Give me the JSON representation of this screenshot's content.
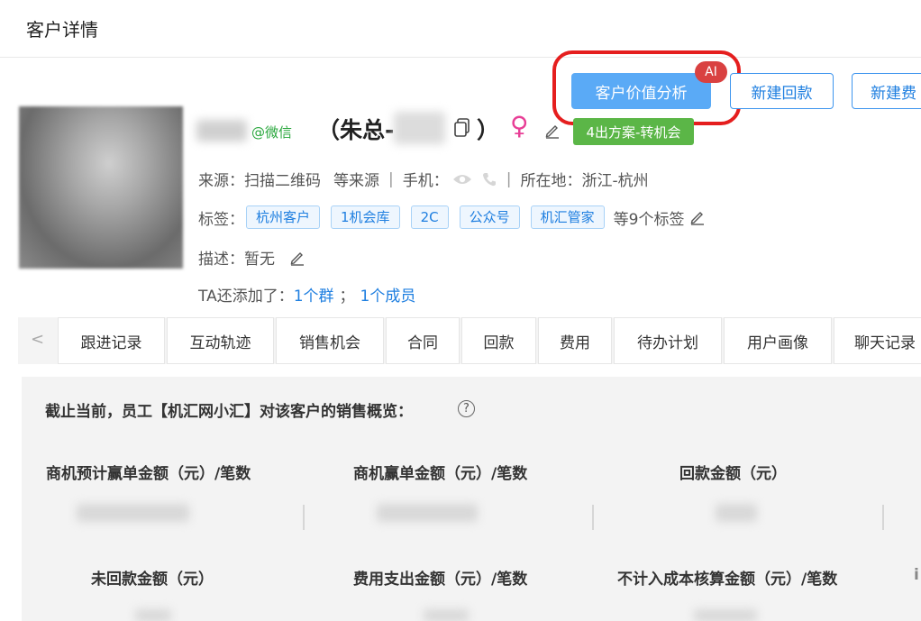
{
  "header": {
    "title": "客户详情"
  },
  "actions": {
    "value_analysis": "客户价值分析",
    "ai_badge": "AI",
    "new_refund": "新建回款",
    "new_expense": "新建费"
  },
  "customer": {
    "wechat_tag": "@微信",
    "title_prefix": "（朱总-",
    "title_suffix": "）",
    "status_badge": "4出方案-转机会",
    "gender_symbol": "♀"
  },
  "info": {
    "source_label": "来源：",
    "source_value": "扫描二维码",
    "source_more": "等来源",
    "phone_label": "手机：",
    "location_label": "所在地：",
    "location_value": "浙江-杭州",
    "tags_label": "标签：",
    "tags": [
      "杭州客户",
      "1机会库",
      "2C",
      "公众号",
      "机汇管家"
    ],
    "tags_more": "等9个标签",
    "desc_label": "描述：",
    "desc_value": "暂无",
    "groups_prefix": "TA还添加了：",
    "groups_link": "1个群",
    "groups_sep": "；",
    "members_link": "1个成员"
  },
  "tabs": {
    "arrow": "<",
    "items": [
      "跟进记录",
      "互动轨迹",
      "销售机会",
      "合同",
      "回款",
      "费用",
      "待办计划",
      "用户画像",
      "聊天记录"
    ]
  },
  "summary": {
    "text": "截止当前，员工【机汇网小汇】对该客户的销售概览：",
    "help": "?"
  },
  "metrics": {
    "row1": [
      "商机预计赢单金额（元）/笔数",
      "商机赢单金额（元）/笔数",
      "回款金额（元）"
    ],
    "row2": [
      "未回款金额（元）",
      "费用支出金额（元）/笔数",
      "不计入成本核算金额（元）/笔数",
      "i"
    ]
  }
}
